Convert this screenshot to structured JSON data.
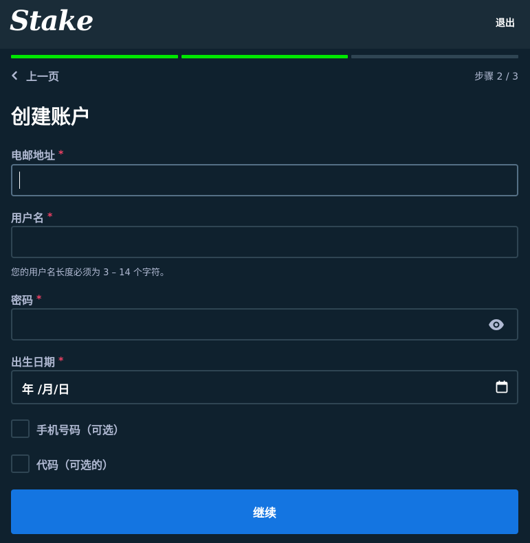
{
  "header": {
    "logo_text": "Stake",
    "logout_label": "退出"
  },
  "progress": {
    "current_step": 2,
    "total_steps": 3
  },
  "nav": {
    "back_label": "上一页",
    "step_text": "步骤 2 / 3"
  },
  "form": {
    "title": "创建账户",
    "email": {
      "label": "电邮地址",
      "required": "*",
      "value": ""
    },
    "username": {
      "label": "用户名",
      "required": "*",
      "value": "",
      "hint": "您的用户名长度必须为 3 – 14 个字符。"
    },
    "password": {
      "label": "密码",
      "required": "*",
      "value": ""
    },
    "birthdate": {
      "label": "出生日期",
      "required": "*",
      "placeholder": "年 /月/日"
    },
    "phone_option": {
      "label": "手机号码（可选）",
      "checked": false
    },
    "code_option": {
      "label": "代码（可选的）",
      "checked": false
    },
    "submit_label": "继续"
  },
  "colors": {
    "background": "#0f212e",
    "header": "#1a2c38",
    "progress_done": "#00e701",
    "progress_pending": "#2f4553",
    "accent": "#1475e1",
    "required": "#ed4163"
  },
  "icons": {
    "back": "chevron-left-icon",
    "password_toggle": "eye-icon",
    "date_picker": "calendar-icon"
  }
}
